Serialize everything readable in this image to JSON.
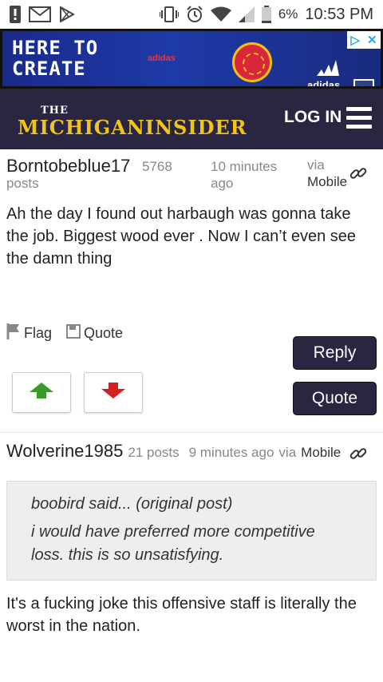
{
  "status_bar": {
    "battery": "6%",
    "time": "10:53 PM"
  },
  "ad": {
    "headline_line1": "HERE TO",
    "headline_line2": "CREATE",
    "brand1": "adidas",
    "brand2": "adidas"
  },
  "header": {
    "brand_the": "THE",
    "brand_name": "MICHIGANINSIDER",
    "login": "LOG IN"
  },
  "posts": [
    {
      "author": "Borntobeblue17",
      "post_count": "5768 posts",
      "time": "10 minutes ago",
      "via": "via",
      "device": "Mobile",
      "body": "Ah the day I found out harbaugh was gonna take the job. Biggest wood ever . Now I can’t even see the damn thing"
    },
    {
      "author": "Wolverine1985",
      "post_count": "21 posts",
      "time": "9 minutes ago",
      "via": "via",
      "device": "Mobile",
      "quote_header": "boobird said... (original post)",
      "quote_text": "i would have preferred more competitive loss. this is so unsatisfying.",
      "body": "It's a fucking joke this offensive staff is literally the worst in the nation."
    }
  ],
  "actions": {
    "flag": "Flag",
    "quote": "Quote",
    "reply_button": "Reply",
    "quote_button": "Quote"
  },
  "colors": {
    "header_bg": "#2a2540",
    "brand_gold": "#f0c419",
    "upvote": "#3a9a2a",
    "downvote": "#d42020"
  },
  "icons": [
    "alert-icon",
    "mail-icon",
    "play-store-icon",
    "vibrate-icon",
    "alarm-icon",
    "wifi-icon",
    "signal-icon",
    "battery-icon",
    "menu-icon",
    "flag-icon",
    "save-icon",
    "link-icon",
    "arrow-up-icon",
    "arrow-down-icon"
  ]
}
